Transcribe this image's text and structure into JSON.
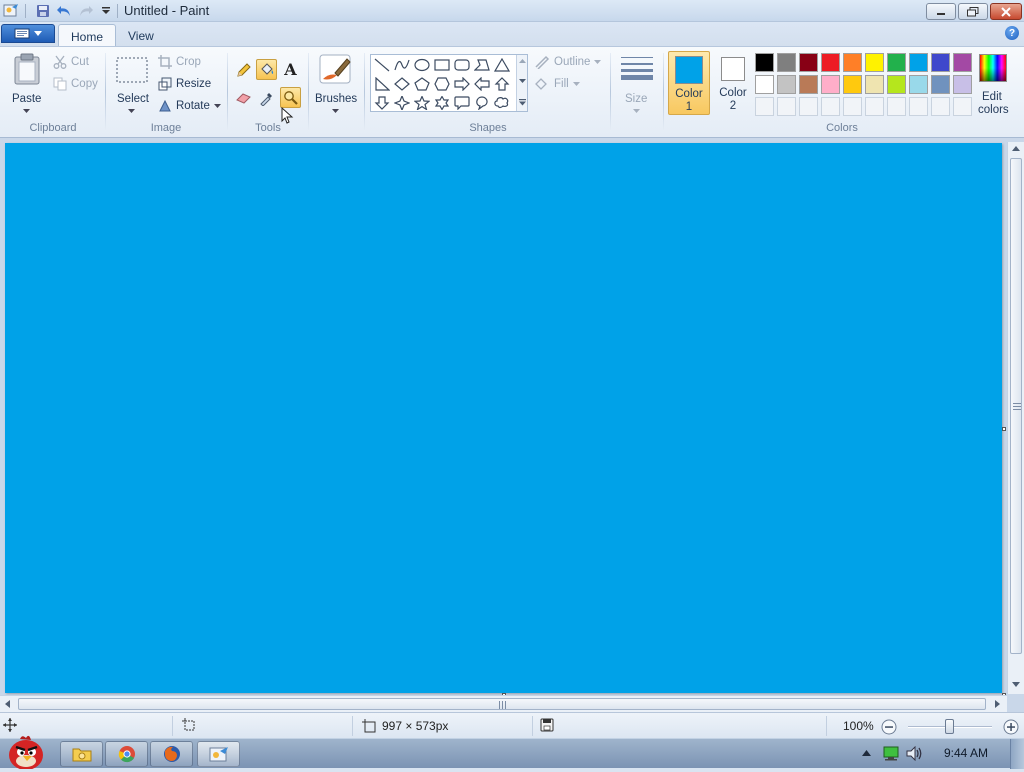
{
  "window": {
    "title": "Untitled - Paint"
  },
  "tabs": [
    {
      "label": "Home",
      "active": true
    },
    {
      "label": "View",
      "active": false
    }
  ],
  "clipboard": {
    "paste_label": "Paste",
    "cut_label": "Cut",
    "copy_label": "Copy",
    "group_label": "Clipboard"
  },
  "image": {
    "select_label": "Select",
    "crop_label": "Crop",
    "resize_label": "Resize",
    "rotate_label": "Rotate",
    "group_label": "Image"
  },
  "tools": {
    "group_label": "Tools",
    "items": [
      "pencil-icon",
      "fill-icon",
      "text-icon",
      "eraser-icon",
      "color-picker-icon",
      "magnifier-icon"
    ],
    "selected": "fill-icon"
  },
  "brushes": {
    "label": "Brushes"
  },
  "shapes": {
    "group_label": "Shapes",
    "outline_label": "Outline",
    "fill_label": "Fill"
  },
  "size": {
    "label": "Size"
  },
  "colors": {
    "group_label": "Colors",
    "color1_label_line1": "Color",
    "color1_label_line2": "1",
    "color2_label_line1": "Color",
    "color2_label_line2": "2",
    "color1": "#00a2e8",
    "color2": "#ffffff",
    "edit_label_line1": "Edit",
    "edit_label_line2": "colors",
    "palette_row1": [
      "#000000",
      "#7f7f7f",
      "#880015",
      "#ed1c24",
      "#ff7f27",
      "#fff200",
      "#22b14c",
      "#00a2e8",
      "#3f48cc",
      "#a349a4"
    ],
    "palette_row2": [
      "#ffffff",
      "#c3c3c3",
      "#b97a57",
      "#ffaec9",
      "#ffc90e",
      "#efe4b0",
      "#b5e61d",
      "#99d9ea",
      "#7092be",
      "#c8bfe7"
    ]
  },
  "canvas": {
    "fill_color": "#00a2e8"
  },
  "status": {
    "image_size": "997 × 573px",
    "zoom": "100%"
  },
  "taskbar": {
    "clock": "9:44 AM",
    "apps": [
      "explorer-icon",
      "chrome-icon",
      "firefox-icon",
      "paint-icon"
    ]
  }
}
